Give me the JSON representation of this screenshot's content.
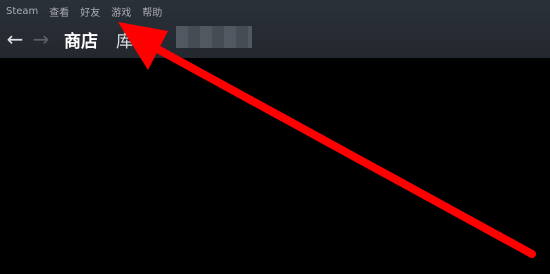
{
  "menubar": {
    "items": [
      {
        "label": "Steam"
      },
      {
        "label": "查看"
      },
      {
        "label": "好友"
      },
      {
        "label": "游戏"
      },
      {
        "label": "帮助"
      }
    ]
  },
  "navbar": {
    "back_icon": "arrow-left-icon",
    "forward_icon": "arrow-right-icon",
    "tabs": [
      {
        "label": "商店",
        "active": true
      },
      {
        "label": "库"
      },
      {
        "label": "区"
      }
    ]
  },
  "annotation": {
    "color": "#ff0000"
  }
}
